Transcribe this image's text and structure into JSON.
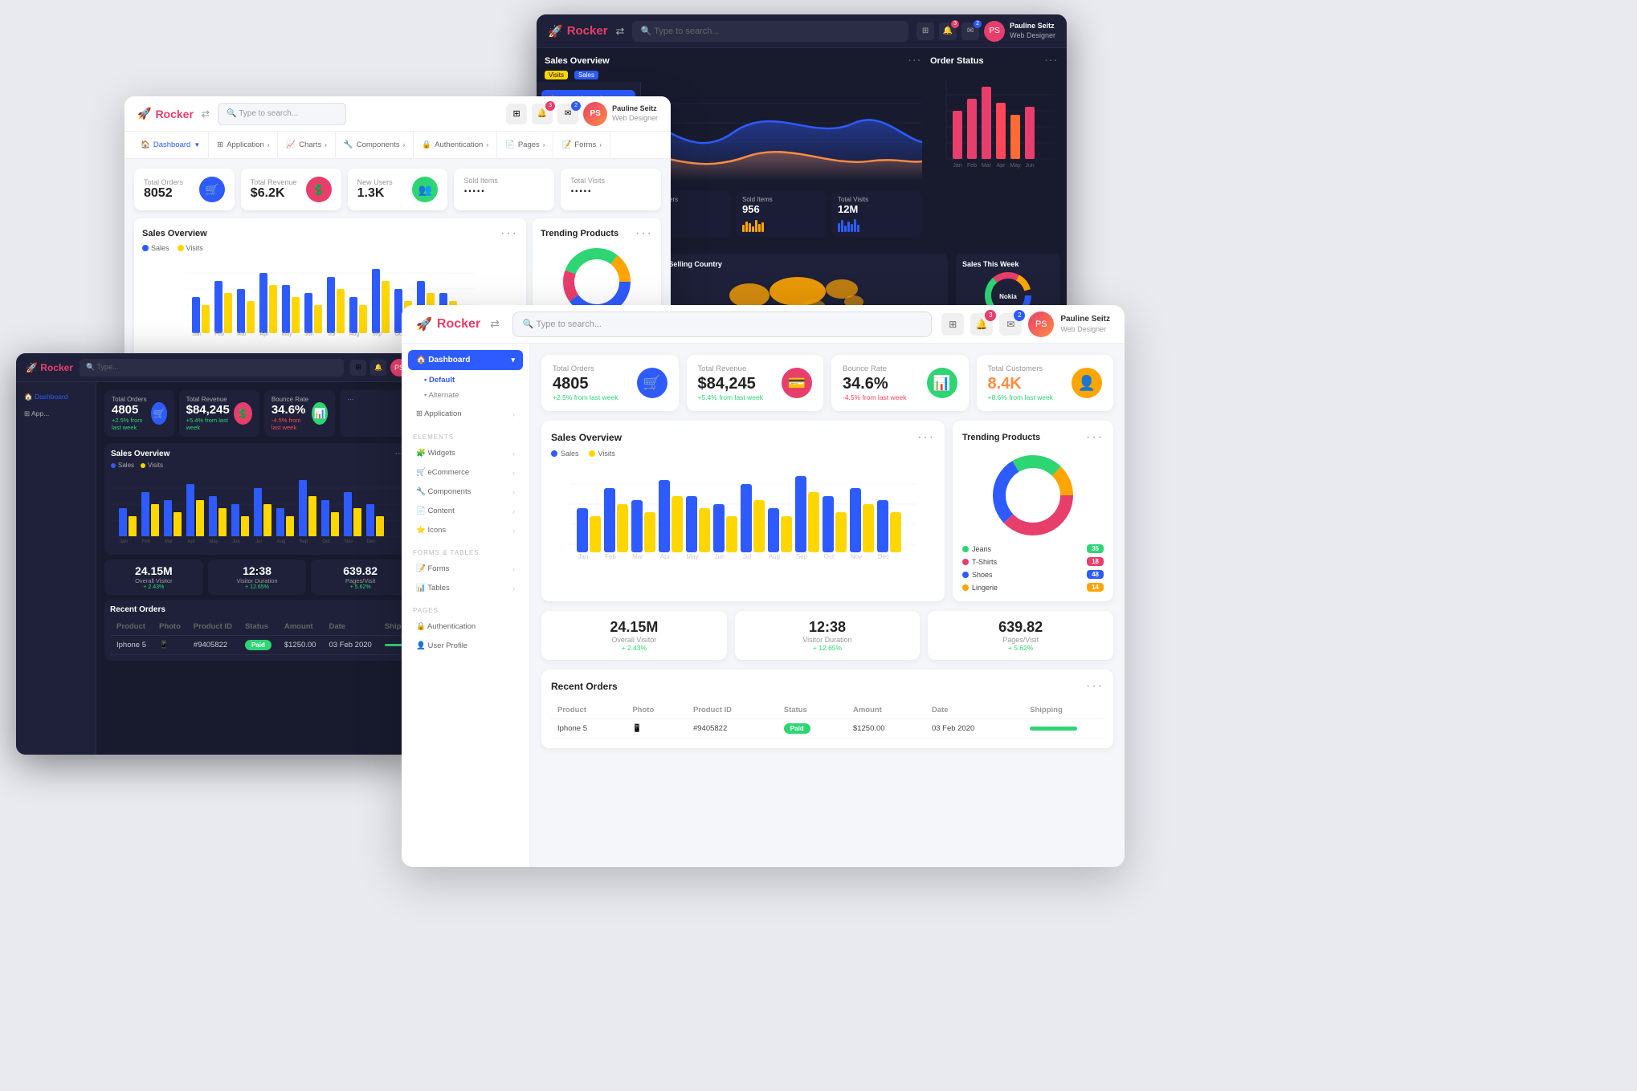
{
  "app": {
    "name": "Rocker",
    "tagline": "Web Designer"
  },
  "user": {
    "name": "Pauline Seitz",
    "role": "Web Designer"
  },
  "search": {
    "placeholder": "Type to search..."
  },
  "nav": {
    "items": [
      "Dashboard",
      "Application",
      "Charts",
      "Components",
      "Authentication",
      "Pages",
      "Forms"
    ]
  },
  "sidebar": {
    "items": [
      "Dashboard",
      "Application"
    ],
    "dashboard_subs": [
      "Default",
      "Alternate"
    ],
    "elements": [
      "Widgets",
      "eCommerce",
      "Components",
      "Content",
      "Icons"
    ],
    "forms_tables": [
      "Forms",
      "Tables"
    ],
    "pages": [
      "Authentication",
      "User Profile"
    ]
  },
  "stats_dark": [
    {
      "label": "Total Orders",
      "value": "4805",
      "change": "+2.5% from last week",
      "positive": true,
      "icon": "🛒",
      "color": "blue"
    },
    {
      "label": "Total Revenue",
      "value": "$84,245",
      "change": "+5.4% from last week",
      "positive": true,
      "icon": "💳",
      "color": "pink"
    },
    {
      "label": "Bounce Rate",
      "value": "34.6%",
      "change": "-4.5% from last week",
      "positive": false,
      "icon": "📊",
      "color": "green"
    },
    {
      "label": "Total Customers",
      "value": "8.4K",
      "change": "+8.6% from last week",
      "positive": true,
      "icon": "👤",
      "color": "orange"
    }
  ],
  "stats_light": [
    {
      "label": "Total Orders",
      "value": "4805",
      "change": "+2.5% from last week",
      "positive": true
    },
    {
      "label": "Total Revenue",
      "value": "$84,245",
      "change": "+5.4% from last week",
      "positive": true
    },
    {
      "label": "Bounce Rate",
      "value": "34.6%",
      "change": "-4.5% from last week",
      "positive": false
    },
    {
      "label": "Total Customers",
      "value": "8.4K",
      "change": "+8.6% from last week",
      "positive": true
    }
  ],
  "win1_stats": [
    {
      "label": "Total Revenue",
      "value": "$6.2K"
    },
    {
      "label": "New Users",
      "value": "1.3K"
    },
    {
      "label": "Sold Items",
      "value": "956"
    },
    {
      "label": "Total Visits",
      "value": "12M"
    }
  ],
  "win2_stats": [
    {
      "label": "Total Orders",
      "value": "8052"
    },
    {
      "label": "Total Revenue",
      "value": "$6.2K"
    },
    {
      "label": "New Users",
      "value": "1.3K"
    },
    {
      "label": "Sold Items",
      "value": ""
    },
    {
      "label": "Total Visits",
      "value": ""
    }
  ],
  "sales_overview": {
    "title": "Sales Overview",
    "legend": [
      "Visits",
      "Sales"
    ]
  },
  "order_status": {
    "title": "Order Status"
  },
  "trending_products": {
    "title": "Trending Products",
    "items": [
      {
        "name": "Jeans",
        "value": 35,
        "color": "#2ed573"
      },
      {
        "name": "T-Shirts",
        "value": 18,
        "color": "#ff4757"
      },
      {
        "name": "Shoes",
        "value": 48,
        "color": "#2e5bff"
      },
      {
        "name": "Lingerie",
        "value": 14,
        "color": "#ffa502"
      }
    ]
  },
  "metrics": [
    {
      "value": "24.15M",
      "label": "Overall Visitor",
      "change": "+ 2.43%"
    },
    {
      "value": "12:38",
      "label": "Visitor Duration",
      "change": "+ 12.65%"
    },
    {
      "value": "639.82",
      "label": "Pages/Visit",
      "change": "+ 5.62%"
    }
  ],
  "recent_orders": {
    "title": "Recent Orders",
    "columns": [
      "Product",
      "Photo",
      "Product ID",
      "Status",
      "Amount",
      "Date",
      "Shipping"
    ],
    "rows": [
      {
        "product": "Iphone 5",
        "photo": "📱",
        "id": "#9405822",
        "status": "Paid",
        "amount": "$1250.00",
        "date": "03 Feb 2020",
        "shipping": 70
      }
    ]
  },
  "top_selling_country": {
    "title": "Top Selling Country"
  },
  "sales_this_week": {
    "title": "Sales This Week",
    "brand": "Nokia"
  }
}
